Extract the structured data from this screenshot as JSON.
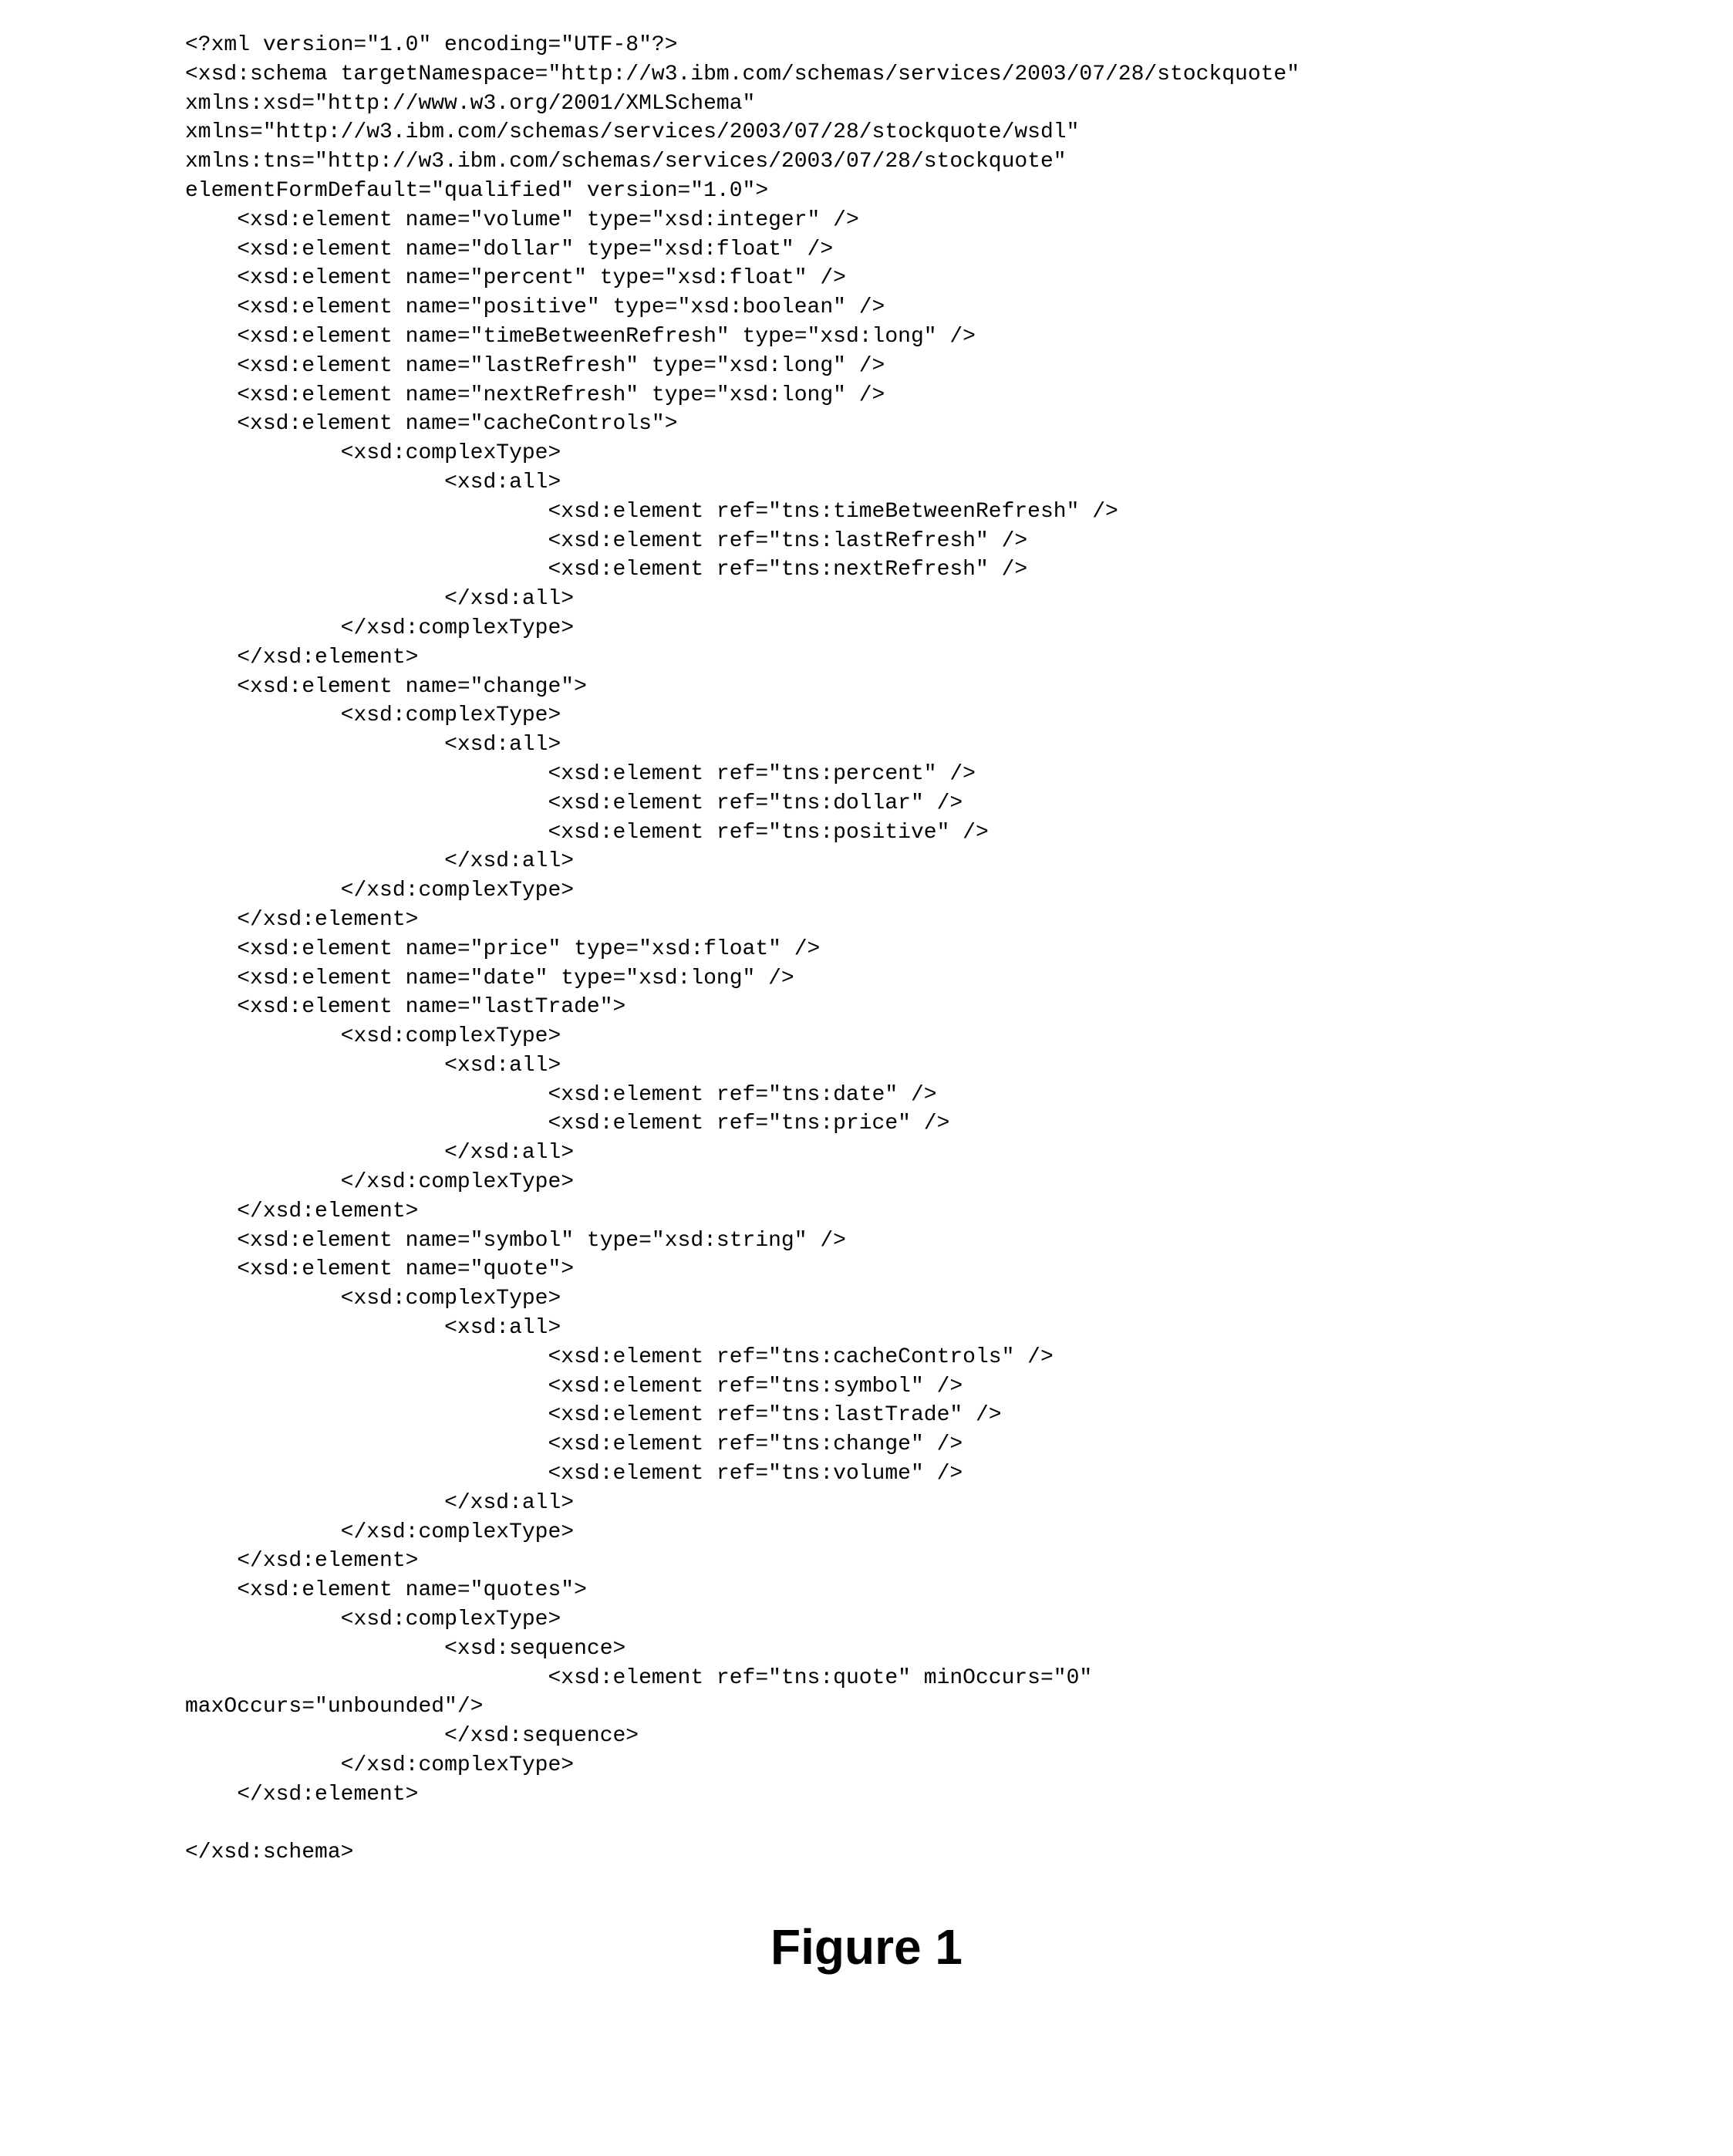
{
  "code": "<?xml version=\"1.0\" encoding=\"UTF-8\"?>\n<xsd:schema targetNamespace=\"http://w3.ibm.com/schemas/services/2003/07/28/stockquote\"\nxmlns:xsd=\"http://www.w3.org/2001/XMLSchema\"\nxmlns=\"http://w3.ibm.com/schemas/services/2003/07/28/stockquote/wsdl\"\nxmlns:tns=\"http://w3.ibm.com/schemas/services/2003/07/28/stockquote\"\nelementFormDefault=\"qualified\" version=\"1.0\">\n    <xsd:element name=\"volume\" type=\"xsd:integer\" />\n    <xsd:element name=\"dollar\" type=\"xsd:float\" />\n    <xsd:element name=\"percent\" type=\"xsd:float\" />\n    <xsd:element name=\"positive\" type=\"xsd:boolean\" />\n    <xsd:element name=\"timeBetweenRefresh\" type=\"xsd:long\" />\n    <xsd:element name=\"lastRefresh\" type=\"xsd:long\" />\n    <xsd:element name=\"nextRefresh\" type=\"xsd:long\" />\n    <xsd:element name=\"cacheControls\">\n            <xsd:complexType>\n                    <xsd:all>\n                            <xsd:element ref=\"tns:timeBetweenRefresh\" />\n                            <xsd:element ref=\"tns:lastRefresh\" />\n                            <xsd:element ref=\"tns:nextRefresh\" />\n                    </xsd:all>\n            </xsd:complexType>\n    </xsd:element>\n    <xsd:element name=\"change\">\n            <xsd:complexType>\n                    <xsd:all>\n                            <xsd:element ref=\"tns:percent\" />\n                            <xsd:element ref=\"tns:dollar\" />\n                            <xsd:element ref=\"tns:positive\" />\n                    </xsd:all>\n            </xsd:complexType>\n    </xsd:element>\n    <xsd:element name=\"price\" type=\"xsd:float\" />\n    <xsd:element name=\"date\" type=\"xsd:long\" />\n    <xsd:element name=\"lastTrade\">\n            <xsd:complexType>\n                    <xsd:all>\n                            <xsd:element ref=\"tns:date\" />\n                            <xsd:element ref=\"tns:price\" />\n                    </xsd:all>\n            </xsd:complexType>\n    </xsd:element>\n    <xsd:element name=\"symbol\" type=\"xsd:string\" />\n    <xsd:element name=\"quote\">\n            <xsd:complexType>\n                    <xsd:all>\n                            <xsd:element ref=\"tns:cacheControls\" />\n                            <xsd:element ref=\"tns:symbol\" />\n                            <xsd:element ref=\"tns:lastTrade\" />\n                            <xsd:element ref=\"tns:change\" />\n                            <xsd:element ref=\"tns:volume\" />\n                    </xsd:all>\n            </xsd:complexType>\n    </xsd:element>\n    <xsd:element name=\"quotes\">\n            <xsd:complexType>\n                    <xsd:sequence>\n                            <xsd:element ref=\"tns:quote\" minOccurs=\"0\"\nmaxOccurs=\"unbounded\"/>\n                    </xsd:sequence>\n            </xsd:complexType>\n    </xsd:element>\n\n</xsd:schema>",
  "figure_label": "Figure 1"
}
